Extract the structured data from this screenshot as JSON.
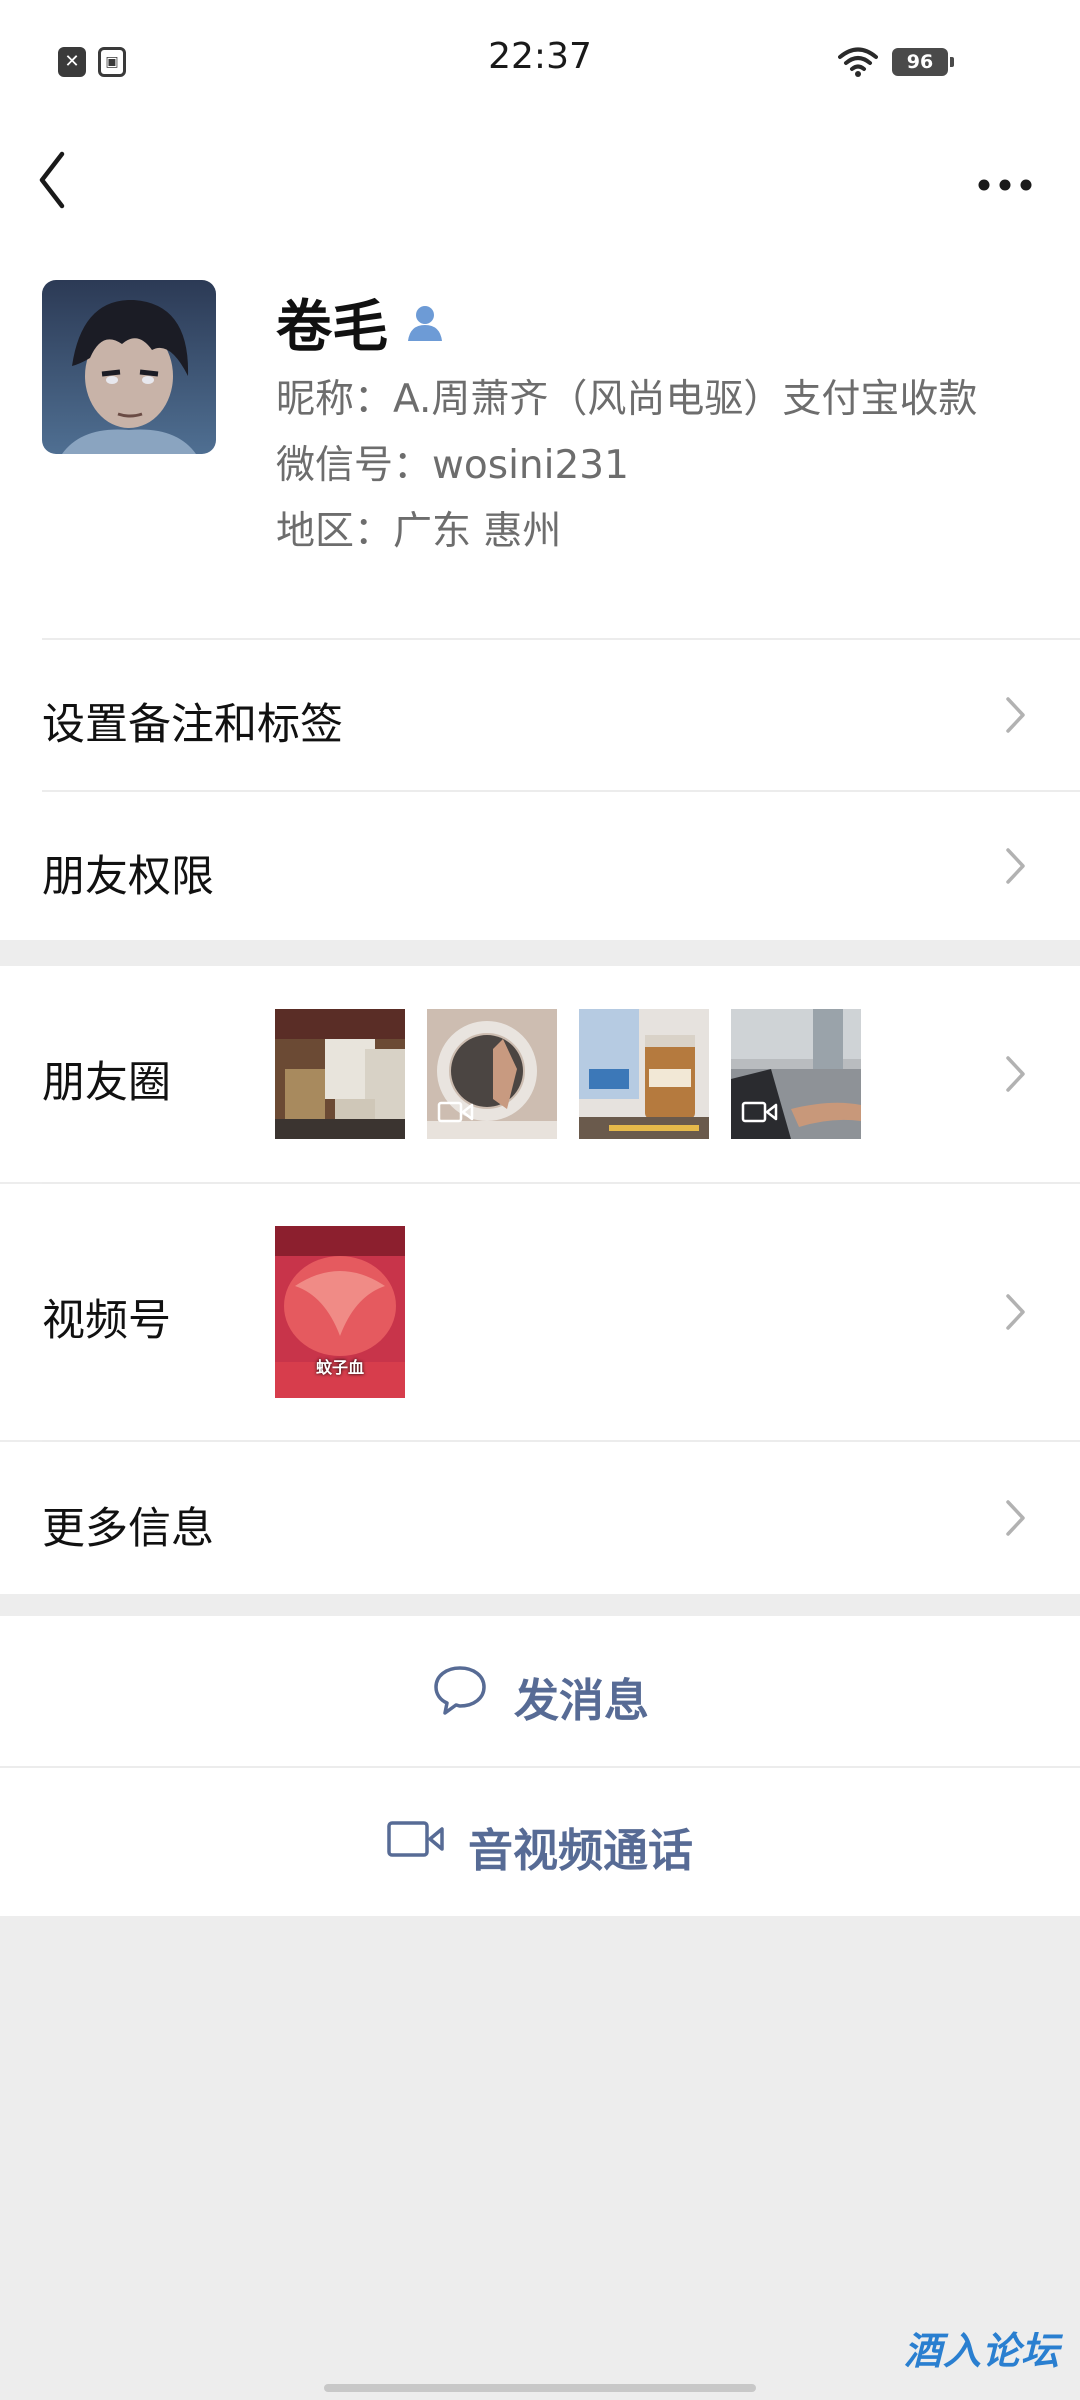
{
  "status_bar": {
    "time": "22:37",
    "battery": "96",
    "left_icons": [
      "close-notification-icon",
      "gallery-notification-icon"
    ],
    "right_icons": [
      "wifi-icon",
      "battery-icon"
    ]
  },
  "nav": {
    "back_icon": "chevron-left-icon",
    "more_icon": "more-dots-icon"
  },
  "profile": {
    "name": "卷毛",
    "nickname": "昵称：A.周萧齐（风尚电驱）支付宝收款",
    "wechat_id": "微信号：wosini231",
    "region": "地区：广东  惠州"
  },
  "menu": {
    "remark_tags": "设置备注和标签",
    "permissions": "朋友权限",
    "moments": "朋友圈",
    "channels": "视频号",
    "more_info": "更多信息"
  },
  "moments_thumbs": [
    {
      "kind": "photo",
      "desc": "warehouse-boxes"
    },
    {
      "kind": "video",
      "desc": "hand-mirror"
    },
    {
      "kind": "photo",
      "desc": "drink-cup"
    },
    {
      "kind": "video",
      "desc": "scooter-road"
    }
  ],
  "channels_thumb_caption": "蚊子血",
  "actions": {
    "message": "发消息",
    "call": "音视频通话"
  },
  "watermark": "酒入论坛",
  "colors": {
    "link_blue": "#576b95",
    "background": "#ededed",
    "card": "#ffffff",
    "watermark_blue": "#2a7fd0"
  }
}
